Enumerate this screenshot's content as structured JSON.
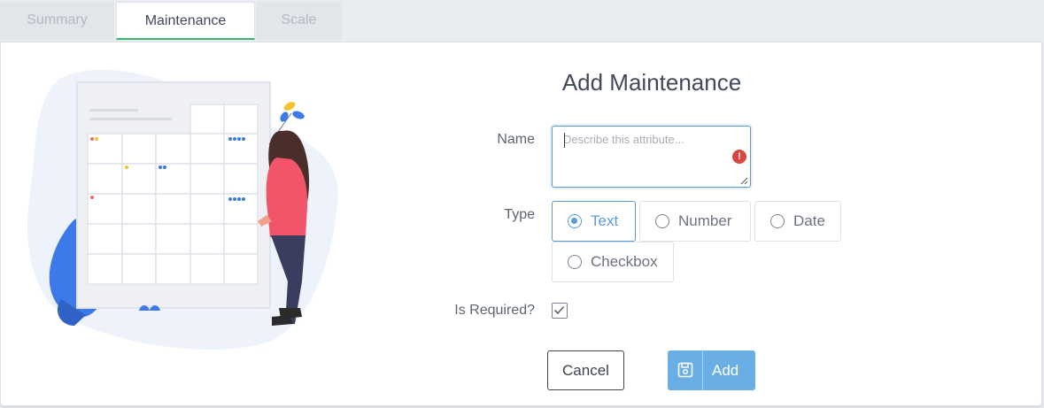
{
  "tabs": [
    {
      "label": "Summary"
    },
    {
      "label": "Maintenance"
    },
    {
      "label": "Scale"
    }
  ],
  "form": {
    "title": "Add Maintenance",
    "name_label": "Name",
    "name_placeholder": "Describe this attribute...",
    "type_label": "Type",
    "type_options": [
      "Text",
      "Number",
      "Date",
      "Checkbox"
    ],
    "selected_type": "Text",
    "required_label": "Is Required?",
    "required_checked": true,
    "cancel_label": "Cancel",
    "add_label": "Add"
  },
  "colors": {
    "accent": "#5b9bd5",
    "active_tab_underline": "#38b56a",
    "error": "#d9463f",
    "primary_button": "#6aaee6"
  },
  "icons": {
    "error": "error-icon",
    "save": "save-icon",
    "check": "checkmark-icon"
  }
}
